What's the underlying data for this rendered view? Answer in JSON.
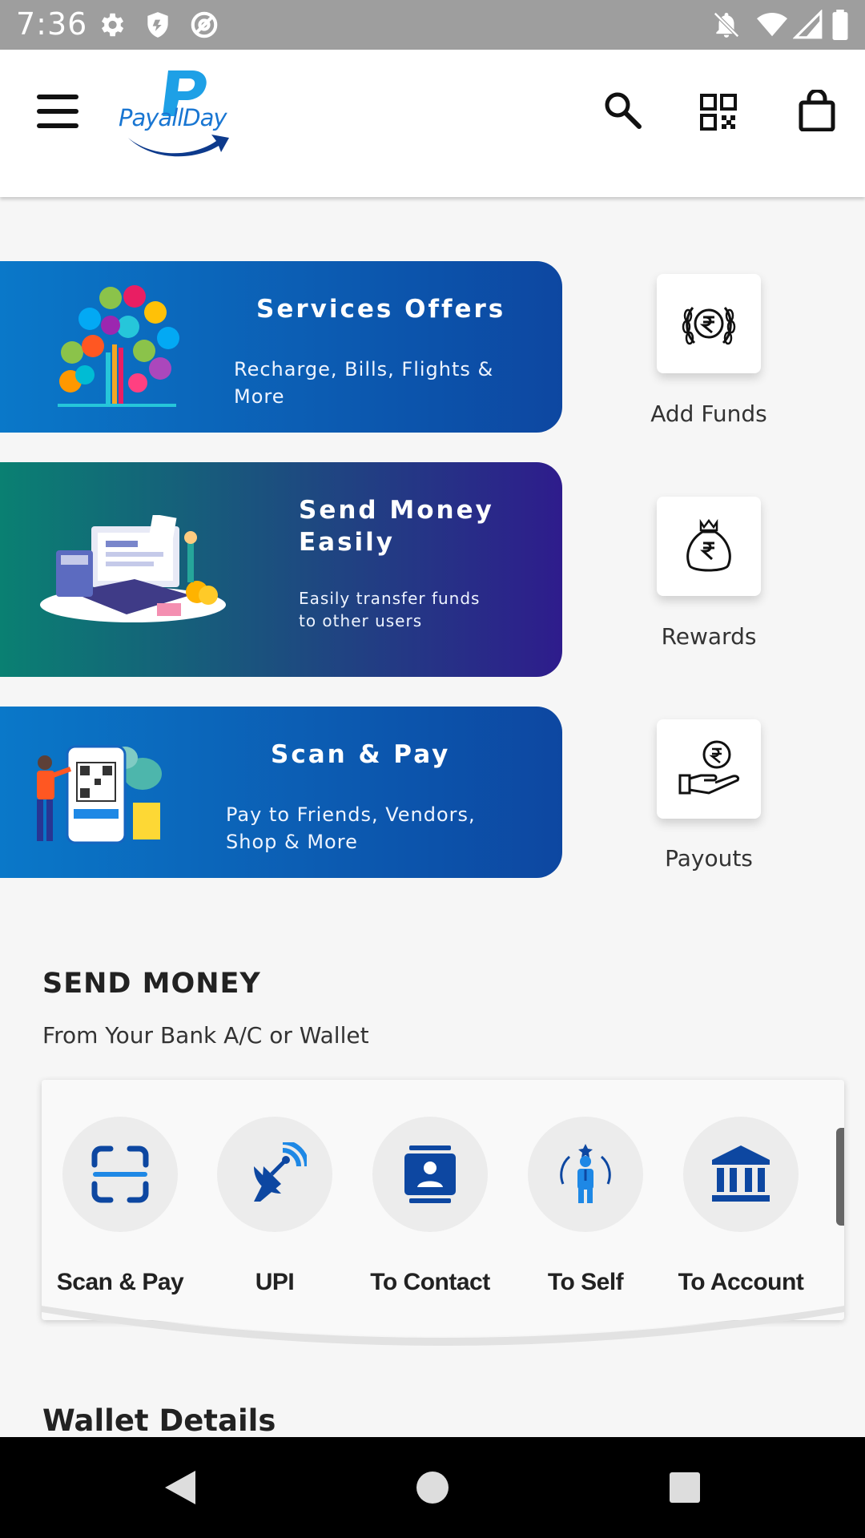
{
  "status_bar": {
    "time": "7:36",
    "icons": [
      "gear-icon",
      "shield-icon",
      "at-sign-icon",
      "notifications-off-icon",
      "wifi-icon",
      "signal-icon",
      "battery-icon"
    ]
  },
  "header": {
    "logo_text": "PayallDay",
    "icons": [
      "menu-icon",
      "search-icon",
      "qr-code-icon",
      "shopping-bag-icon"
    ],
    "brand_color": "#1976d2"
  },
  "promo_cards": [
    {
      "title": "Services Offers",
      "subtitle": "Recharge, Bills, Flights & More"
    },
    {
      "title": "Send Money Easily",
      "subtitle": "Easily transfer funds to other users"
    },
    {
      "title": "Scan & Pay",
      "subtitle": "Pay to Friends, Vendors, Shop & More"
    }
  ],
  "quick_tiles": [
    {
      "label": "Add Funds",
      "icon": "rupee-wreath-icon"
    },
    {
      "label": "Rewards",
      "icon": "money-bag-icon"
    },
    {
      "label": "Payouts",
      "icon": "hand-rupee-icon"
    }
  ],
  "send_money": {
    "title": "SEND MONEY",
    "subtitle": "From Your Bank A/C or Wallet",
    "actions": [
      {
        "label": "Scan & Pay",
        "icon": "scan-icon"
      },
      {
        "label": "UPI",
        "icon": "satellite-dish-icon"
      },
      {
        "label": "To Contact",
        "icon": "contact-card-icon"
      },
      {
        "label": "To Self",
        "icon": "person-star-icon"
      },
      {
        "label": "To Account",
        "icon": "bank-icon"
      }
    ]
  },
  "wallet": {
    "title": "Wallet Details"
  },
  "nav_bar": {
    "icons": [
      "back-icon",
      "home-icon",
      "recents-icon"
    ]
  }
}
